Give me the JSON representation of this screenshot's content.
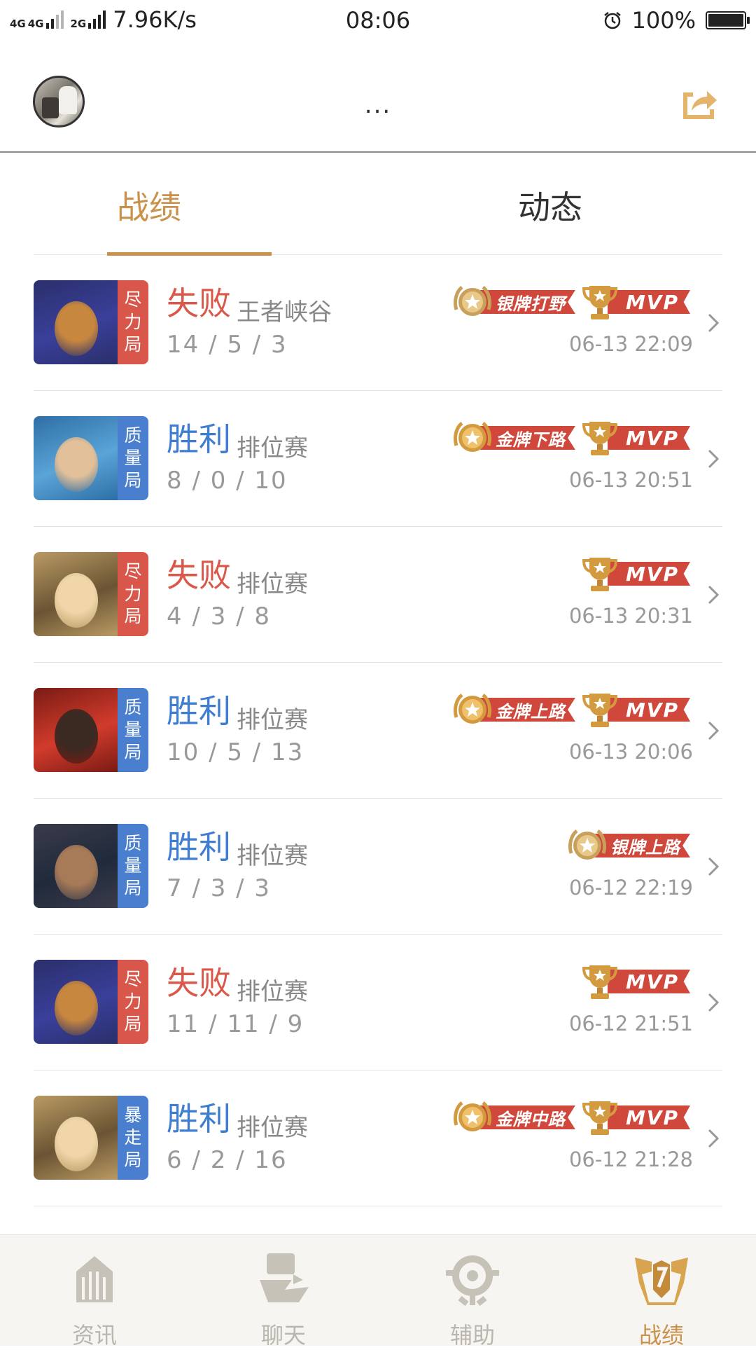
{
  "status_bar": {
    "net1": "4G",
    "net2": "4G",
    "net3": "2G",
    "speed": "7.96K/s",
    "time": "08:06",
    "battery_text": "100%",
    "battery_level": 1.0
  },
  "header": {
    "title": "...",
    "avatar_icon": "avatar",
    "share_icon": "share-icon"
  },
  "tabs": [
    {
      "label": "战绩",
      "active": true
    },
    {
      "label": "动态",
      "active": false
    }
  ],
  "matches": [
    {
      "tag": [
        "尽",
        "力",
        "局"
      ],
      "tag_color": "#d9574a",
      "result": "失败",
      "result_type": "lose",
      "mode": "王者峡谷",
      "kda": "14 / 5 / 3",
      "date": "06-13 22:09",
      "medal_label": "银牌打野",
      "medal_type": "silver",
      "mvp": true,
      "mvp_label": "MVP"
    },
    {
      "tag": [
        "质",
        "量",
        "局"
      ],
      "tag_color": "#4a7fd0",
      "result": "胜利",
      "result_type": "win",
      "mode": "排位赛",
      "kda": "8 / 0 / 10",
      "date": "06-13 20:51",
      "medal_label": "金牌下路",
      "medal_type": "gold",
      "mvp": true,
      "mvp_label": "MVP"
    },
    {
      "tag": [
        "尽",
        "力",
        "局"
      ],
      "tag_color": "#d9574a",
      "result": "失败",
      "result_type": "lose",
      "mode": "排位赛",
      "kda": "4 / 3 / 8",
      "date": "06-13 20:31",
      "medal_label": "",
      "medal_type": "",
      "mvp": true,
      "mvp_label": "MVP"
    },
    {
      "tag": [
        "质",
        "量",
        "局"
      ],
      "tag_color": "#4a7fd0",
      "result": "胜利",
      "result_type": "win",
      "mode": "排位赛",
      "kda": "10 / 5 / 13",
      "date": "06-13 20:06",
      "medal_label": "金牌上路",
      "medal_type": "gold",
      "mvp": true,
      "mvp_label": "MVP"
    },
    {
      "tag": [
        "质",
        "量",
        "局"
      ],
      "tag_color": "#4a7fd0",
      "result": "胜利",
      "result_type": "win",
      "mode": "排位赛",
      "kda": "7 / 3 / 3",
      "date": "06-12 22:19",
      "medal_label": "银牌上路",
      "medal_type": "silver",
      "mvp": false,
      "mvp_label": ""
    },
    {
      "tag": [
        "尽",
        "力",
        "局"
      ],
      "tag_color": "#d9574a",
      "result": "失败",
      "result_type": "lose",
      "mode": "排位赛",
      "kda": "11 / 11 / 9",
      "date": "06-12 21:51",
      "medal_label": "",
      "medal_type": "",
      "mvp": true,
      "mvp_label": "MVP"
    },
    {
      "tag": [
        "暴",
        "走",
        "局"
      ],
      "tag_color": "#4a7fd0",
      "result": "胜利",
      "result_type": "win",
      "mode": "排位赛",
      "kda": "6 / 2 / 16",
      "date": "06-12 21:28",
      "medal_label": "金牌中路",
      "medal_type": "gold",
      "mvp": true,
      "mvp_label": "MVP"
    }
  ],
  "bottom_nav": [
    {
      "label": "资讯",
      "icon": "news-icon",
      "active": false
    },
    {
      "label": "聊天",
      "icon": "chat-icon",
      "active": false
    },
    {
      "label": "辅助",
      "icon": "assist-icon",
      "active": false
    },
    {
      "label": "战绩",
      "icon": "record-icon",
      "active": true
    }
  ],
  "colors": {
    "accent": "#c9914a",
    "win": "#3f7dd0",
    "lose": "#d9584a",
    "ribbon": "#d0473b"
  }
}
